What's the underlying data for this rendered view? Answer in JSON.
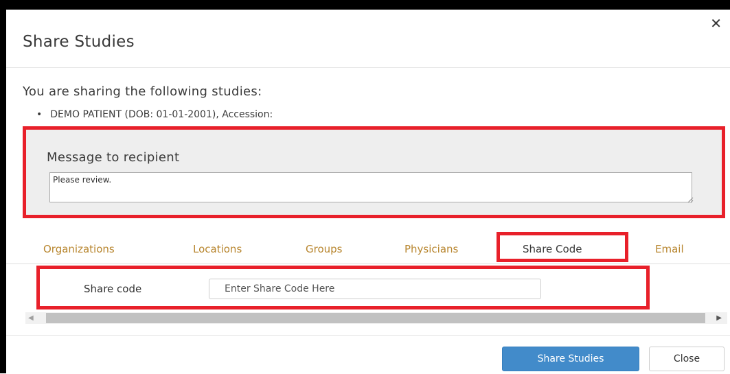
{
  "dialog": {
    "title": "Share Studies",
    "close_icon": "close-icon"
  },
  "studies": {
    "intro": "You are sharing the following studies:",
    "items": [
      "DEMO PATIENT (DOB: 01-01-2001), Accession:"
    ]
  },
  "message": {
    "label": "Message to recipient",
    "value": "Please review."
  },
  "tabs": [
    {
      "label": "Organizations"
    },
    {
      "label": "Locations"
    },
    {
      "label": "Groups"
    },
    {
      "label": "Physicians"
    },
    {
      "label": "Share Code",
      "active": true
    },
    {
      "label": "Email"
    }
  ],
  "share_code": {
    "label": "Share code",
    "placeholder": "Enter Share Code Here",
    "value": ""
  },
  "footer": {
    "share_label": "Share Studies",
    "close_label": "Close"
  },
  "colors": {
    "highlight": "#e8202a",
    "primary": "#428bca",
    "tab_link": "#b8862f"
  }
}
